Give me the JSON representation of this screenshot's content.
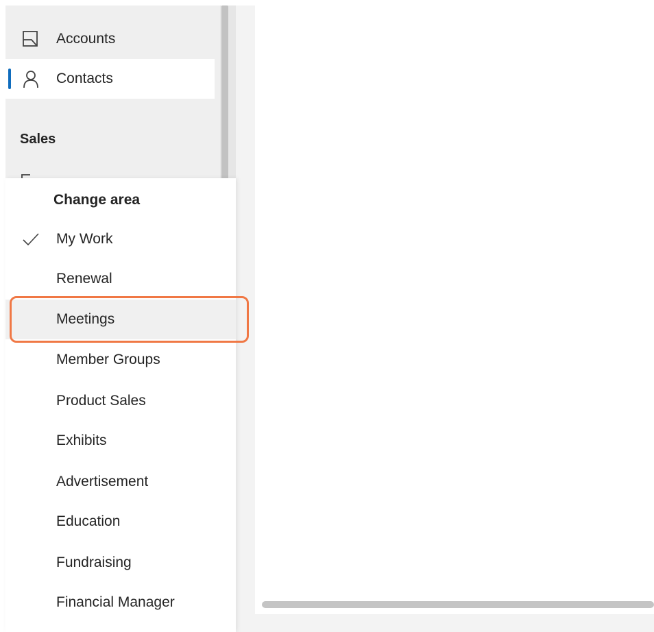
{
  "sidebar": {
    "items": [
      {
        "label": "Accounts",
        "icon": "accounts-icon"
      },
      {
        "label": "Contacts",
        "icon": "contacts-icon",
        "selected": true
      }
    ],
    "section_header": "Sales"
  },
  "change_area": {
    "title": "Change area",
    "items": [
      {
        "label": "My Work",
        "checked": true
      },
      {
        "label": "Renewal"
      },
      {
        "label": "Meetings",
        "highlighted": true
      },
      {
        "label": "Member Groups"
      },
      {
        "label": "Product Sales"
      },
      {
        "label": "Exhibits"
      },
      {
        "label": "Advertisement"
      },
      {
        "label": "Education"
      },
      {
        "label": "Fundraising"
      },
      {
        "label": "Financial Manager"
      }
    ]
  },
  "colors": {
    "selection_accent": "#0f6cbd",
    "highlight_ring": "#f07845",
    "sidebar_bg": "#efefef"
  }
}
